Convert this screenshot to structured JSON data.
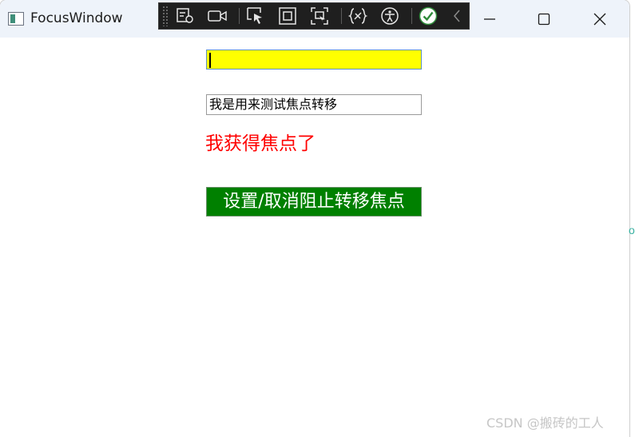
{
  "window": {
    "title": "FocusWindow",
    "controls": [
      "minimize-icon",
      "maximize-icon",
      "close-icon"
    ]
  },
  "debug_toolbar": {
    "buttons": [
      "select-element-icon",
      "record-icon",
      "pointer-select-icon",
      "display-adorner-icon",
      "track-focus-icon",
      "binding-failures-icon",
      "accessibility-icon",
      "check-circle-icon",
      "collapse-chevron-icon"
    ]
  },
  "content": {
    "focused_input_value": "",
    "focused_input_bg": "#ffff00",
    "text_input_value": "我是用来测试焦点转移",
    "focus_label": "我获得焦点了",
    "focus_label_color": "#ff0000",
    "toggle_button_label": "设置/取消阻止转移焦点",
    "toggle_button_bg": "#008000"
  },
  "watermark": "CSDN @搬砖的工人"
}
